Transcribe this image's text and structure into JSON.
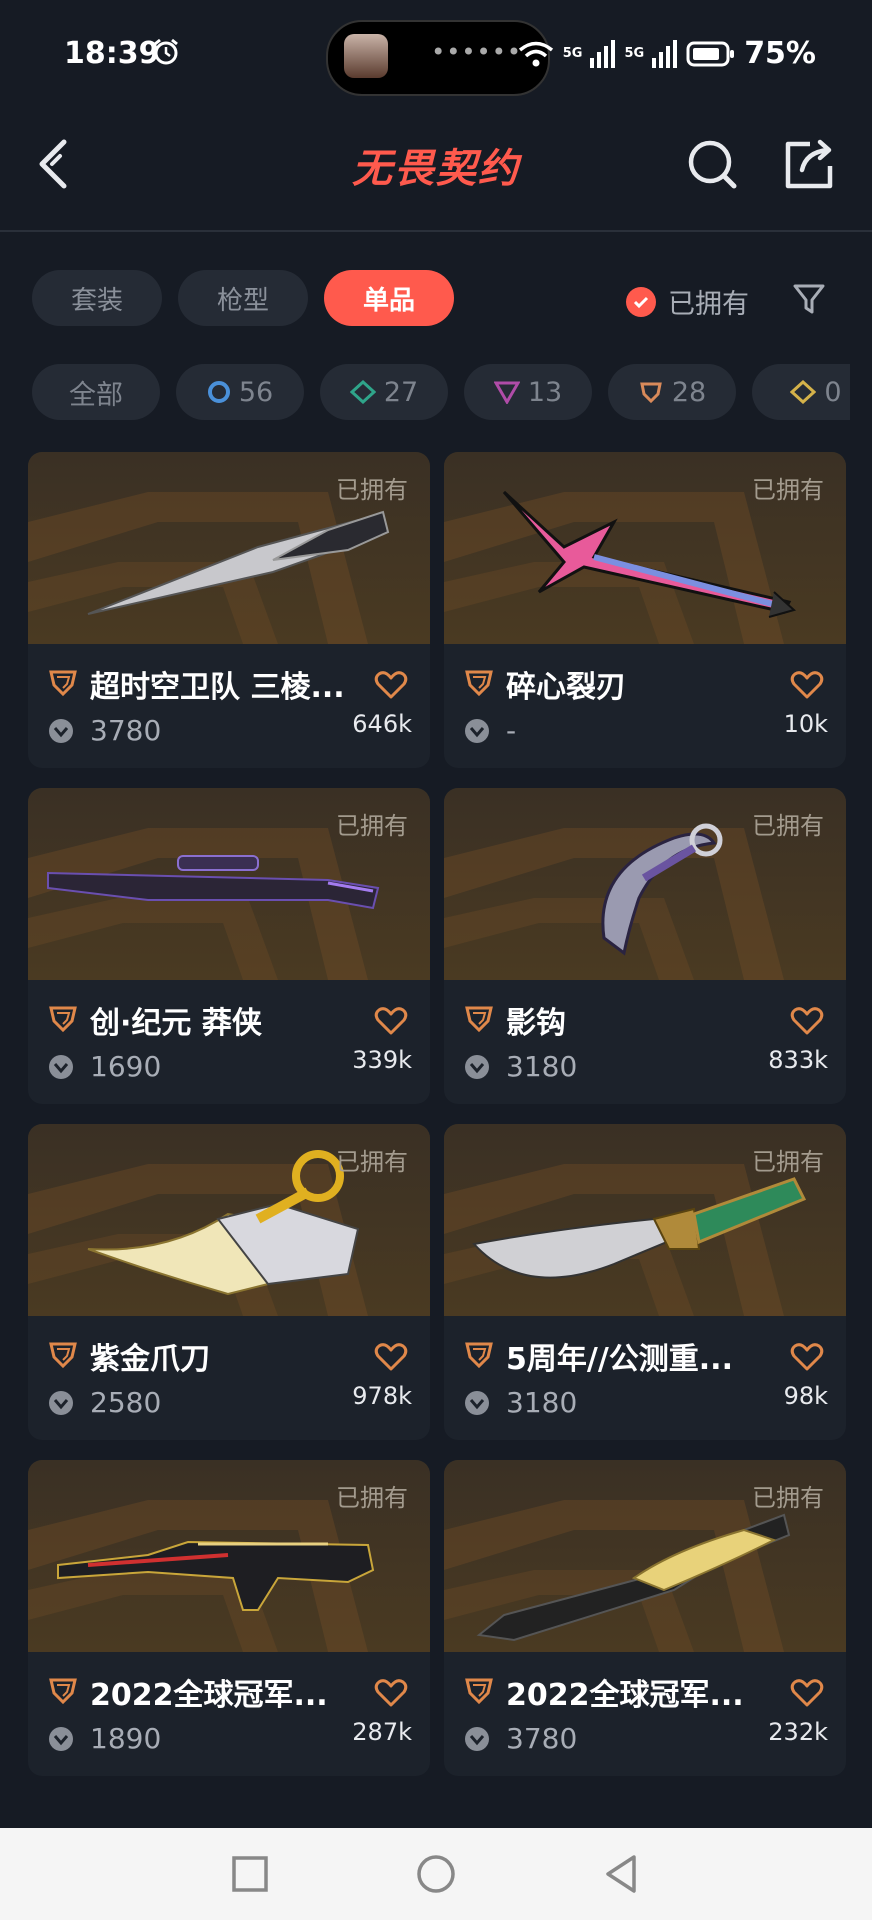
{
  "status_bar": {
    "time": "18:39",
    "battery": "75%",
    "signal1": "5G",
    "signal2": "5G"
  },
  "header": {
    "title": "无畏契约"
  },
  "tabs": [
    {
      "label": "套装",
      "active": false
    },
    {
      "label": "枪型",
      "active": false
    },
    {
      "label": "单品",
      "active": true
    }
  ],
  "owned_toggle": {
    "label": "已拥有",
    "checked": true
  },
  "chips": [
    {
      "label": "全部",
      "icon": "none"
    },
    {
      "label": "56",
      "icon": "ring-blue-icon"
    },
    {
      "label": "27",
      "icon": "diamond-green-icon"
    },
    {
      "label": "13",
      "icon": "triangle-purple-icon"
    },
    {
      "label": "28",
      "icon": "pentagon-orange-icon"
    },
    {
      "label": "0",
      "icon": "diamond-gold-icon"
    }
  ],
  "items": [
    {
      "name": "超时空卫队 三棱...",
      "price": "3780",
      "likes": "646k",
      "owned_label": "已拥有",
      "weapon": "knife"
    },
    {
      "name": "碎心裂刃",
      "price": "-",
      "likes": "10k",
      "owned_label": "已拥有",
      "weapon": "spear"
    },
    {
      "name": "创·纪元 莽侠",
      "price": "1690",
      "likes": "339k",
      "owned_label": "已拥有",
      "weapon": "rifle"
    },
    {
      "name": "影钩",
      "price": "3180",
      "likes": "833k",
      "owned_label": "已拥有",
      "weapon": "karambit"
    },
    {
      "name": "紫金爪刀",
      "price": "2580",
      "likes": "978k",
      "owned_label": "已拥有",
      "weapon": "claw"
    },
    {
      "name": "5周年//公测重...",
      "price": "3180",
      "likes": "98k",
      "owned_label": "已拥有",
      "weapon": "dagger"
    },
    {
      "name": "2022全球冠军...",
      "price": "1890",
      "likes": "287k",
      "owned_label": "已拥有",
      "weapon": "smg"
    },
    {
      "name": "2022全球冠军...",
      "price": "3780",
      "likes": "232k",
      "owned_label": "已拥有",
      "weapon": "butterfly"
    }
  ],
  "colors": {
    "accent": "#ff5a4d",
    "background": "#161b24",
    "card": "#1c222b",
    "tier": "#e0884a"
  }
}
